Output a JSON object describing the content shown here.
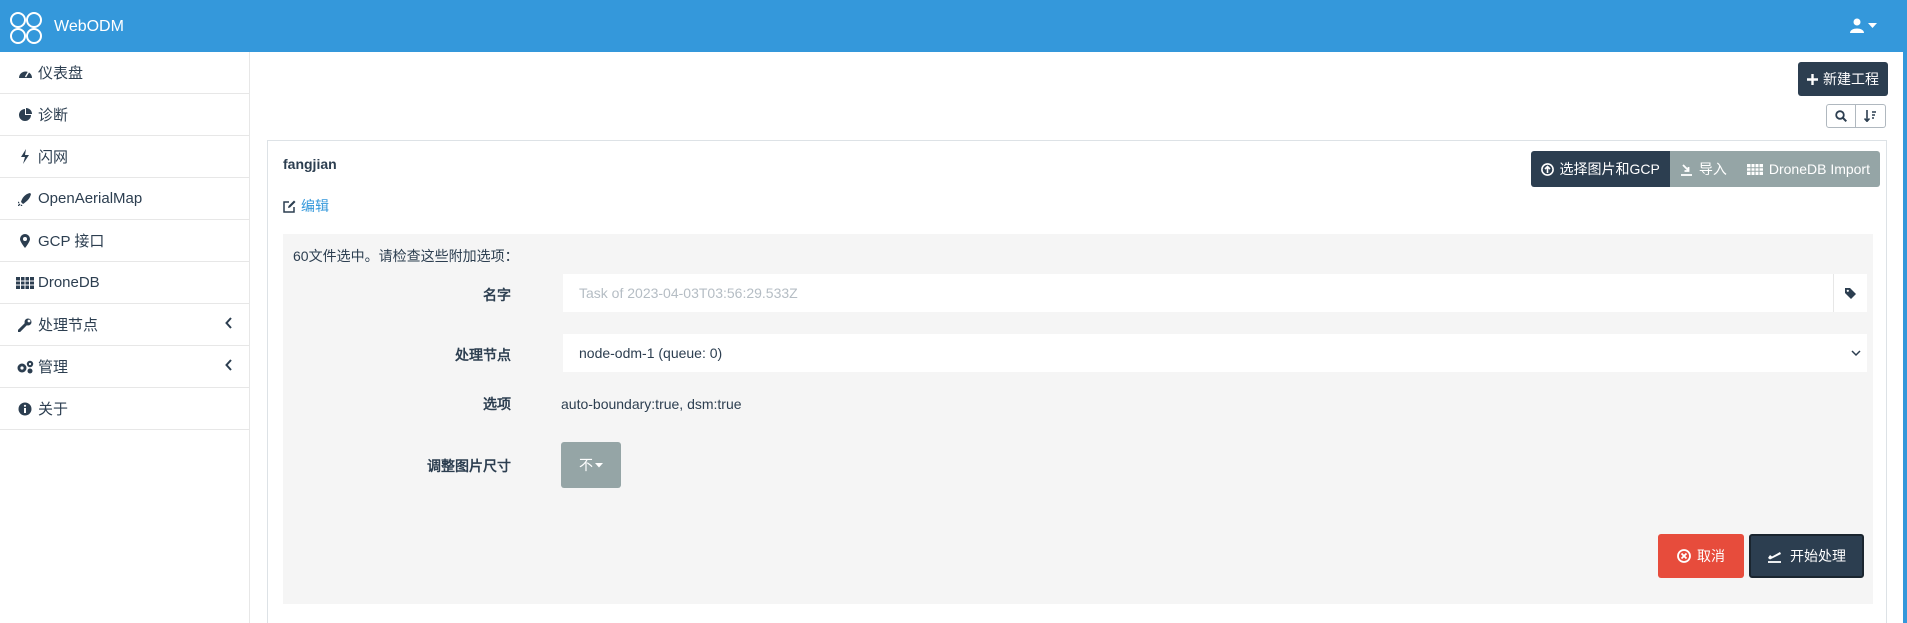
{
  "header": {
    "app_title": "WebODM"
  },
  "sidebar": {
    "items": [
      {
        "label": "仪表盘",
        "icon": "dashboard-icon"
      },
      {
        "label": "诊断",
        "icon": "pie-chart-icon"
      },
      {
        "label": "闪网",
        "icon": "bolt-icon"
      },
      {
        "label": "OpenAerialMap",
        "icon": "rocket-icon"
      },
      {
        "label": "GCP 接口",
        "icon": "map-marker-icon"
      },
      {
        "label": "DroneDB",
        "icon": "grid-icon"
      },
      {
        "label": "处理节点",
        "icon": "wrench-icon",
        "expandable": true
      },
      {
        "label": "管理",
        "icon": "cogs-icon",
        "expandable": true
      },
      {
        "label": "关于",
        "icon": "info-icon"
      }
    ]
  },
  "toolbar": {
    "new_project_label": "新建工程"
  },
  "project": {
    "name": "fangjian",
    "edit_label": "编辑",
    "actions": {
      "select_images_label": "选择图片和GCP",
      "import_label": "导入",
      "dronedb_label": "DroneDB Import"
    }
  },
  "task_form": {
    "files_info": "60文件选中。请检查这些附加选项：",
    "name_label": "名字",
    "name_placeholder": "Task of 2023-04-03T03:56:29.533Z",
    "node_label": "处理节点",
    "node_value": "node-odm-1 (queue: 0)",
    "options_label": "选项",
    "options_value": "auto-boundary:true, dsm:true",
    "resize_label": "调整图片尺寸",
    "resize_value": "不",
    "cancel_label": "取消",
    "start_label": "开始处理"
  },
  "colors": {
    "navbar": "#3498db",
    "primary": "#2c3e50",
    "secondary": "#95a5a6",
    "danger": "#e74c3c",
    "link": "#3498db"
  }
}
